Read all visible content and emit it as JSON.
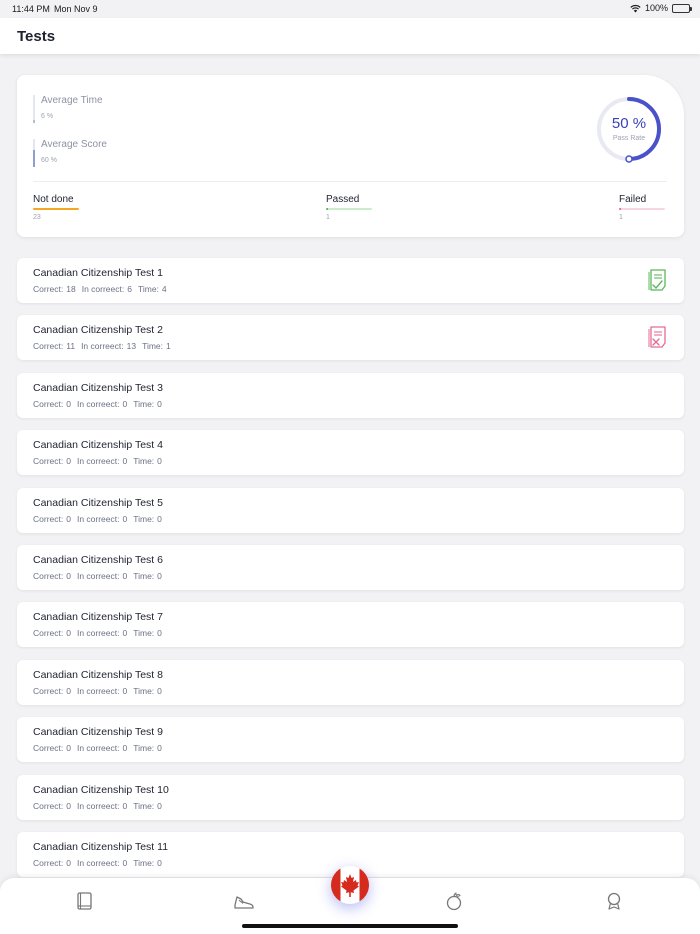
{
  "status_bar": {
    "time": "11:44 PM",
    "date": "Mon Nov 9",
    "battery": "100%"
  },
  "header": {
    "title": "Tests"
  },
  "summary": {
    "average_time": {
      "label": "Average Time",
      "value": "6 %"
    },
    "average_score": {
      "label": "Average Score",
      "value": "60 %"
    },
    "pass_rate": {
      "value": "50 %",
      "label": "Pass Rate",
      "fraction": 0.5
    },
    "not_done": {
      "label": "Not done",
      "count": "23",
      "color": "#f5a623"
    },
    "passed": {
      "label": "Passed",
      "count": "1",
      "color": "#9fdc9f"
    },
    "failed": {
      "label": "Failed",
      "count": "1",
      "color": "#f2a9bd"
    }
  },
  "meta_labels": {
    "correct": "Correct:",
    "incorrect": "In correect:",
    "time": "Time:"
  },
  "tests": [
    {
      "name": "Canadian Citizenship Test 1",
      "correct": "18",
      "incorrect": "6",
      "time": "4",
      "status": "passed"
    },
    {
      "name": "Canadian Citizenship Test 2",
      "correct": "11",
      "incorrect": "13",
      "time": "1",
      "status": "failed"
    },
    {
      "name": "Canadian Citizenship Test 3",
      "correct": "0",
      "incorrect": "0",
      "time": "0",
      "status": "none"
    },
    {
      "name": "Canadian Citizenship Test 4",
      "correct": "0",
      "incorrect": "0",
      "time": "0",
      "status": "none"
    },
    {
      "name": "Canadian Citizenship Test 5",
      "correct": "0",
      "incorrect": "0",
      "time": "0",
      "status": "none"
    },
    {
      "name": "Canadian Citizenship Test 6",
      "correct": "0",
      "incorrect": "0",
      "time": "0",
      "status": "none"
    },
    {
      "name": "Canadian Citizenship Test 7",
      "correct": "0",
      "incorrect": "0",
      "time": "0",
      "status": "none"
    },
    {
      "name": "Canadian Citizenship Test 8",
      "correct": "0",
      "incorrect": "0",
      "time": "0",
      "status": "none"
    },
    {
      "name": "Canadian Citizenship Test 9",
      "correct": "0",
      "incorrect": "0",
      "time": "0",
      "status": "none"
    },
    {
      "name": "Canadian Citizenship Test 10",
      "correct": "0",
      "incorrect": "0",
      "time": "0",
      "status": "none"
    },
    {
      "name": "Canadian Citizenship Test 11",
      "correct": "0",
      "incorrect": "0",
      "time": "0",
      "status": "none"
    }
  ],
  "colors": {
    "accent": "#3b42b8",
    "pass_icon": "#5cb85c",
    "fail_icon": "#e56d94"
  },
  "tab_bar": {
    "tabs": [
      "book-icon",
      "shoe-icon",
      "canada-flag-icon",
      "fruit-icon",
      "award-icon"
    ]
  }
}
